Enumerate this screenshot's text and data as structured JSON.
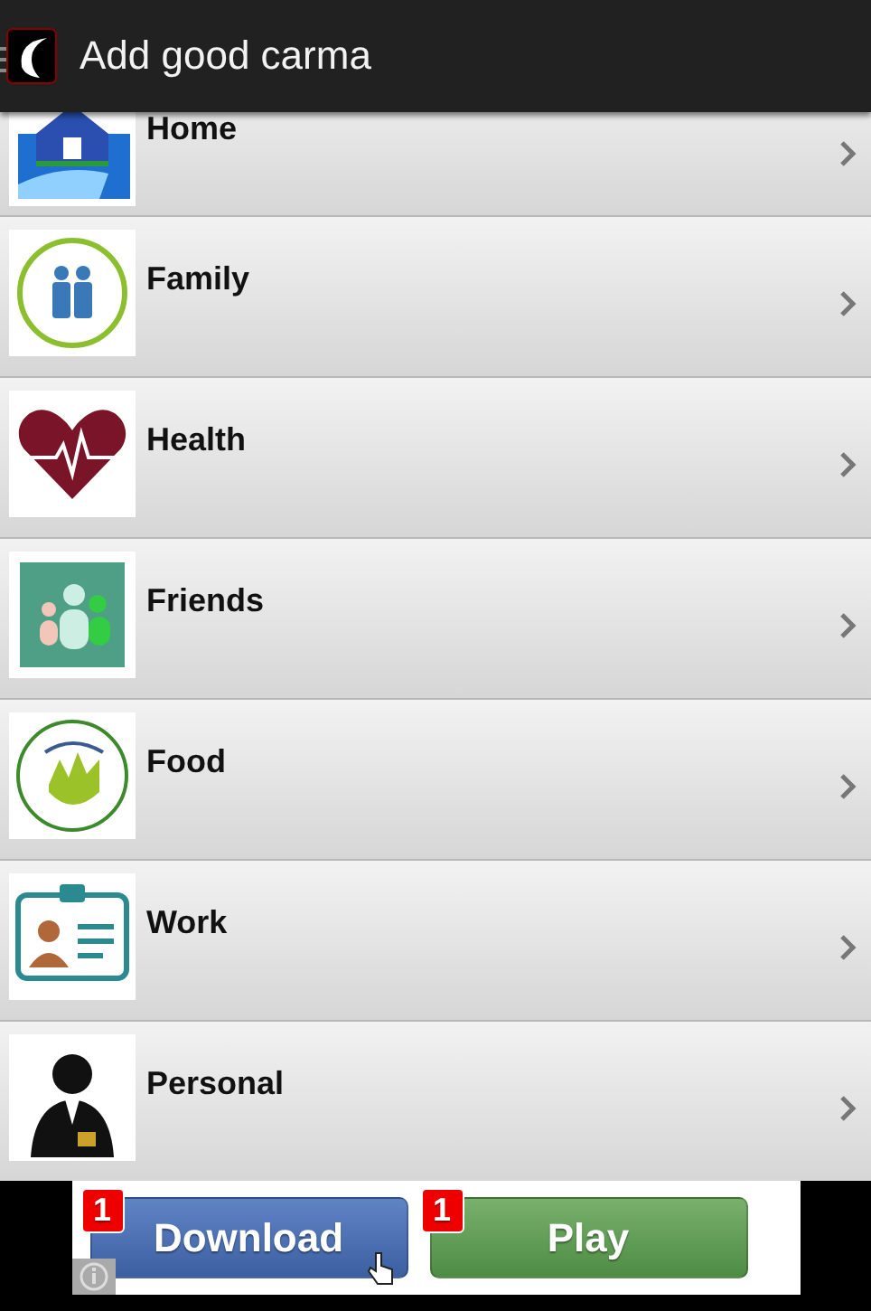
{
  "action_bar": {
    "title": "Add good carma"
  },
  "items": [
    {
      "label": "Home"
    },
    {
      "label": "Family"
    },
    {
      "label": "Health"
    },
    {
      "label": "Friends"
    },
    {
      "label": "Food"
    },
    {
      "label": "Work"
    },
    {
      "label": "Personal"
    }
  ],
  "ad": {
    "buttons": [
      {
        "label": "Download",
        "badge": "1",
        "kind": "blue"
      },
      {
        "label": "Play",
        "badge": "1",
        "kind": "green"
      }
    ]
  }
}
